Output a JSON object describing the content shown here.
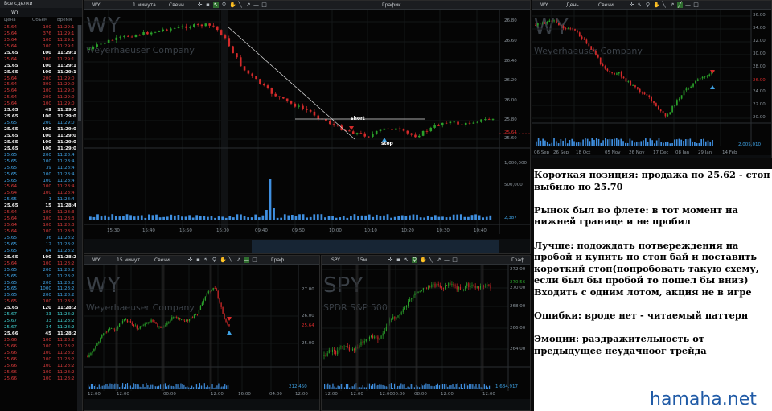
{
  "book": {
    "title": "Все сделки",
    "symbol": "WY",
    "columns": [
      "Цена",
      "Объем",
      "Время"
    ],
    "rows": [
      [
        "25.64",
        "100",
        "11:29:1",
        "r"
      ],
      [
        "25.64",
        "376",
        "11:29:1",
        "r"
      ],
      [
        "25.64",
        "100",
        "11:29:1",
        "r"
      ],
      [
        "25.64",
        "100",
        "11:29:1",
        "r"
      ],
      [
        "25.65",
        "100",
        "11:29:1",
        "w"
      ],
      [
        "25.64",
        "100",
        "11:29:1",
        "r"
      ],
      [
        "25.65",
        "100",
        "11:29:1",
        "w"
      ],
      [
        "25.65",
        "100",
        "11:29:1",
        "w"
      ],
      [
        "25.64",
        "200",
        "11:29:0",
        "r"
      ],
      [
        "25.64",
        "300",
        "11:29:0",
        "r"
      ],
      [
        "25.64",
        "100",
        "11:29:0",
        "r"
      ],
      [
        "25.64",
        "200",
        "11:29:0",
        "r"
      ],
      [
        "25.64",
        "100",
        "11:29:0",
        "r"
      ],
      [
        "25.65",
        "49",
        "11:29:0",
        "w"
      ],
      [
        "25.65",
        "100",
        "11:29:0",
        "w"
      ],
      [
        "25.65",
        "200",
        "11:29:0",
        "b"
      ],
      [
        "25.65",
        "100",
        "11:29:0",
        "w"
      ],
      [
        "25.65",
        "100",
        "11:29:0",
        "w"
      ],
      [
        "25.65",
        "100",
        "11:29:0",
        "w"
      ],
      [
        "25.65",
        "100",
        "11:29:0",
        "w"
      ],
      [
        "25.65",
        "200",
        "11:28:4",
        "b"
      ],
      [
        "25.65",
        "100",
        "11:28:4",
        "b"
      ],
      [
        "25.65",
        "39",
        "11:28:4",
        "b"
      ],
      [
        "25.65",
        "100",
        "11:28:4",
        "b"
      ],
      [
        "25.65",
        "100",
        "11:28:4",
        "b"
      ],
      [
        "25.64",
        "100",
        "11:28:4",
        "r"
      ],
      [
        "25.64",
        "100",
        "11:28:4",
        "r"
      ],
      [
        "25.65",
        "1",
        "11:28:4",
        "b"
      ],
      [
        "25.65",
        "15",
        "11:28:4",
        "w"
      ],
      [
        "25.64",
        "100",
        "11:28:3",
        "r"
      ],
      [
        "25.64",
        "100",
        "11:28:3",
        "r"
      ],
      [
        "25.64",
        "100",
        "11:28:3",
        "r"
      ],
      [
        "25.64",
        "100",
        "11:28:3",
        "r"
      ],
      [
        "25.65",
        "36",
        "11:28:2",
        "b"
      ],
      [
        "25.65",
        "12",
        "11:28:2",
        "b"
      ],
      [
        "25.65",
        "64",
        "11:28:2",
        "b"
      ],
      [
        "25.65",
        "100",
        "11:28:2",
        "w"
      ],
      [
        "25.64",
        "100",
        "11:28:2",
        "r"
      ],
      [
        "25.65",
        "200",
        "11:28:2",
        "b"
      ],
      [
        "25.65",
        "30",
        "11:28:2",
        "b"
      ],
      [
        "25.65",
        "200",
        "11:28:2",
        "b"
      ],
      [
        "25.65",
        "1000",
        "11:28:2",
        "b"
      ],
      [
        "25.65",
        "200",
        "11:28:2",
        "b"
      ],
      [
        "25.65",
        "100",
        "11:28:2",
        "r"
      ],
      [
        "25.65",
        "120",
        "11:28:2",
        "w"
      ],
      [
        "25.67",
        "33",
        "11:28:2",
        "c"
      ],
      [
        "25.67",
        "33",
        "11:28:2",
        "c"
      ],
      [
        "25.67",
        "34",
        "11:28:2",
        "c"
      ],
      [
        "25.66",
        "45",
        "11:28:2",
        "w"
      ],
      [
        "25.66",
        "100",
        "11:28:2",
        "r"
      ],
      [
        "25.66",
        "100",
        "11:28:2",
        "r"
      ],
      [
        "25.66",
        "100",
        "11:28:2",
        "r"
      ],
      [
        "25.66",
        "100",
        "11:28:2",
        "r"
      ],
      [
        "25.66",
        "100",
        "11:28:2",
        "r"
      ],
      [
        "25.66",
        "100",
        "11:28:2",
        "r"
      ],
      [
        "25.66",
        "100",
        "11:28:2",
        "r"
      ]
    ]
  },
  "main": {
    "symbol": "WY",
    "interval": "1 минута",
    "style": "Свечи",
    "label": "График",
    "title": "WY",
    "company": "Weyerhaeuser Company",
    "price_ticks": [
      "26.80",
      "26.60",
      "26.40",
      "26.20",
      "26.00",
      "25.80",
      "25.60"
    ],
    "last_price": "25.64",
    "volume_ticks": [
      "1,000,000",
      "500,000"
    ],
    "volume_last": "2,387",
    "time_ticks": [
      "15:30",
      "15:40",
      "15:50",
      "16:00",
      "09:40",
      "09:50",
      "10:00",
      "10:10",
      "10:20",
      "10:30",
      "10:40"
    ],
    "annotations": {
      "short": "short",
      "stop": "stop"
    }
  },
  "daily": {
    "symbol": "WY",
    "interval": "День",
    "style": "Свечи",
    "title": "WY",
    "company": "Weyerhaeuser Company",
    "price_ticks": [
      "36.00",
      "34.00",
      "32.00",
      "30.00",
      "28.00",
      "26.00",
      "24.00",
      "22.00",
      "20.00"
    ],
    "last_price": "26.00",
    "volume_last": "2,005,010",
    "time_ticks": [
      "06 Sep",
      "26 Sep",
      "18 Oct",
      "05 Nov",
      "26 Nov",
      "17 Dec",
      "08 Jan",
      "29 Jan",
      "14 Feb"
    ]
  },
  "m15": {
    "symbol": "WY",
    "interval": "15 минут",
    "style": "Свечи",
    "label": "Граф",
    "title": "WY",
    "company": "Weyerhaeuser Company",
    "price_ticks": [
      "27.00",
      "26.00",
      "25.00"
    ],
    "last_price": "25.64",
    "volume_last": "212,450",
    "time_ticks": [
      "12:00",
      "12:00",
      "00:00",
      "12:00",
      "16:00",
      "04:00",
      "12:00"
    ]
  },
  "spy": {
    "symbol": "SPY",
    "interval": "15м",
    "label": "Граф",
    "title": "SPY",
    "company": "SPDR S&P 500",
    "price_ticks": [
      "272.00",
      "270.00",
      "268.00",
      "266.00",
      "264.00"
    ],
    "last_price": "270.56",
    "volume_last": "1,684,917",
    "time_ticks": [
      "12:00",
      "12:00",
      "12:00",
      "00:00",
      "08:00",
      "12:00",
      "12:00"
    ]
  },
  "note": {
    "text": "Короткая позиция: продажа по 25.62 - стоп выбило по 25.70\n\nРынок был во флете: в тот момент на нижней границе и не пробил\n\nЛучше: подождать потвереждения на пробой и купить по стоп бай и поставить короткий стоп(попробовать такую схему, если был бы пробой то пошел бы вниз)\nВходить с одним лотом, акция не в игре\n\nОшибки: вроде нет - читаемый паттерн\n\nЭмоции: раздражительность от предыдущее неудачноог трейда"
  },
  "watermark": "hamaha.net",
  "colors": {
    "up": "#2aa02a",
    "down": "#d42a2a",
    "buy": "#3fa3e6",
    "volume": "#3f8fe0"
  }
}
